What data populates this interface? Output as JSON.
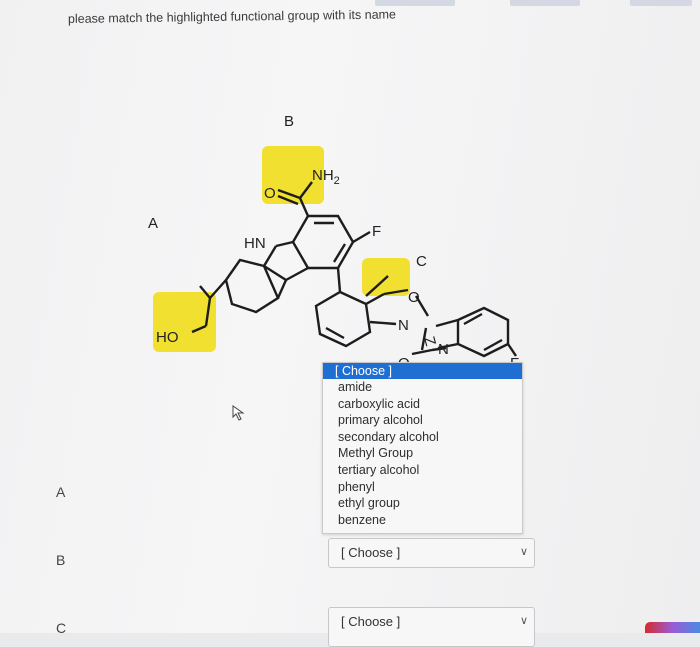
{
  "question": {
    "prompt": "please match the highlighted functional group with its name"
  },
  "molecule": {
    "group_labels": {
      "a": "A",
      "b": "B",
      "c": "C"
    },
    "atoms": {
      "nh2": "NH",
      "nh2_sub": "2",
      "o_carbonyl": "O",
      "hn": "HN",
      "f_top": "F",
      "ho": "HO",
      "o_ring": "O",
      "n_ring": "N",
      "z_ring": "Z",
      "n_imine": "N",
      "o_lower": "O",
      "f_right": "F"
    },
    "highlight_color": "#f2e030"
  },
  "rows": {
    "a_label": "A",
    "b_label": "B",
    "c_label": "C"
  },
  "dropdown": {
    "options": [
      "[ Choose ]",
      "amide",
      "carboxylic acid",
      "primary alcohol",
      "secondary alcohol",
      "Methyl Group",
      "tertiary alcohol",
      "phenyl",
      "ethyl group",
      "benzene"
    ],
    "selected_color": "#1f6fd2"
  },
  "select_b": {
    "value": "[ Choose ]"
  },
  "select_c": {
    "value": "[ Choose ]"
  }
}
